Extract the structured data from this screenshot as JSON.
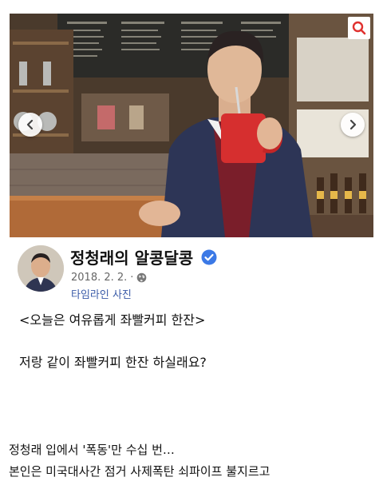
{
  "post": {
    "page_name": "정청래의 알콩달콩",
    "date": "2018. 2. 2.",
    "album": "타임라인 사진",
    "text_line1": "<오늘은 여유롭게 좌빨커피 한잔>",
    "text_line2": "저랑 같이 좌빨커피 한잔 하실래요?"
  },
  "caption": {
    "line1": "정청래 입에서 '폭동'만 수십 번…",
    "line2": "본인은 미국대사간 점거 사제폭탄 쇠파이프 불지르고"
  },
  "icons": {
    "search": "search-icon",
    "prev": "chevron-left-icon",
    "next": "chevron-right-icon",
    "verified": "verified-badge-icon",
    "audience": "globe-icon"
  },
  "colors": {
    "accent_red": "#e0312f",
    "verified_blue": "#3b79e6",
    "link_blue": "#3a5ba8"
  }
}
